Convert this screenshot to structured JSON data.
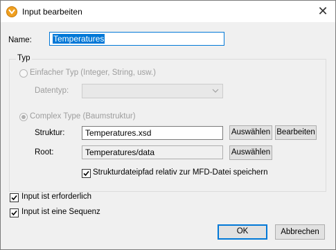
{
  "window": {
    "title": "Input bearbeiten",
    "close_glyph": "✕"
  },
  "name_field": {
    "label": "Name:",
    "value": "Temperatures"
  },
  "typ_group": {
    "title": "Typ",
    "simple_type": {
      "label": "Einfacher Typ (Integer, String, usw.)",
      "selected": false,
      "enabled": false
    },
    "datentyp": {
      "label": "Datentyp:",
      "value": "",
      "enabled": false
    },
    "complex_type": {
      "label": "Complex Type (Baumstruktur)",
      "selected": true,
      "enabled": false
    },
    "struktur": {
      "label": "Struktur:",
      "value": "Temperatures.xsd",
      "choose_button": "Auswählen",
      "edit_button": "Bearbeiten"
    },
    "root": {
      "label": "Root:",
      "value": "Temperatures/data",
      "choose_button": "Auswählen"
    },
    "relative_path": {
      "label": "Strukturdateipfad relativ zur MFD-Datei speichern",
      "checked": true
    }
  },
  "options": {
    "required": {
      "label": "Input ist erforderlich",
      "checked": true
    },
    "sequence": {
      "label": "Input ist eine Sequenz",
      "checked": true
    }
  },
  "buttons": {
    "ok": "OK",
    "cancel": "Abbrechen"
  },
  "colors": {
    "accent": "#0078d7",
    "dialog_bg": "#f0f0f0",
    "app_icon": "#f0a020"
  },
  "icons": {
    "app": "mapforce-logo-icon",
    "close": "close-icon",
    "dropdown": "chevron-down-icon",
    "checkmark": "checkmark-icon"
  }
}
